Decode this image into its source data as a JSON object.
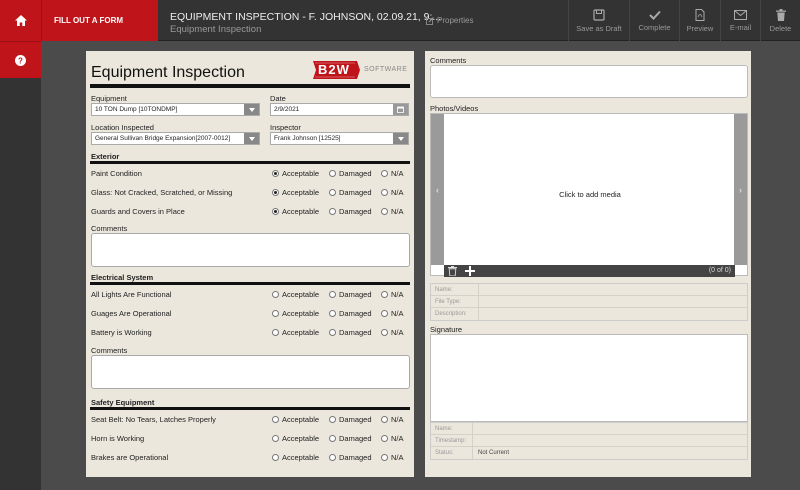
{
  "nav": {
    "fill_form": "FILL OUT A FORM"
  },
  "header": {
    "title": "EQUIPMENT INSPECTION - F. JOHNSON, 02.09.21, 9:...",
    "subtitle": "Equipment Inspection",
    "properties": "Properties"
  },
  "toolbar": {
    "save_draft": "Save as Draft",
    "complete": "Complete",
    "preview": "Preview",
    "email": "E-mail",
    "delete": "Delete"
  },
  "form": {
    "title": "Equipment Inspection",
    "logo_text": "B2W",
    "logo_sub": "SOFTWARE",
    "equipment_label": "Equipment",
    "equipment_value": "10 TON Dump [10TONDMP]",
    "date_label": "Date",
    "date_value": "2/9/2021",
    "location_label": "Location Inspected",
    "location_value": "General Sullivan Bridge Expansion[2007-0012]",
    "inspector_label": "Inspector",
    "inspector_value": "Frank Johnson [12525]",
    "options": [
      "Acceptable",
      "Damaged",
      "N/A"
    ],
    "comments_label": "Comments",
    "sections": [
      {
        "title": "Exterior",
        "questions": [
          {
            "text": "Paint Condition",
            "selected": "Acceptable"
          },
          {
            "text": "Glass: Not Cracked, Scratched, or Missing",
            "selected": "Acceptable"
          },
          {
            "text": "Guards and Covers in Place",
            "selected": "Acceptable"
          }
        ]
      },
      {
        "title": "Electrical System",
        "questions": [
          {
            "text": "All Lights Are Functional",
            "selected": ""
          },
          {
            "text": "Guages Are Operational",
            "selected": ""
          },
          {
            "text": "Battery is Working",
            "selected": ""
          }
        ]
      },
      {
        "title": "Safety Equipment",
        "questions": [
          {
            "text": "Seat Belt: No Tears, Latches Properly",
            "selected": ""
          },
          {
            "text": "Horn is Working",
            "selected": ""
          },
          {
            "text": "Brakes are Operational",
            "selected": ""
          }
        ]
      }
    ]
  },
  "right": {
    "comments_label": "Comments",
    "photos_label": "Photos/Videos",
    "click_media": "Click to add media",
    "media_count": "(0 of 0)",
    "media_meta": {
      "name": "Name:",
      "file_type": "File Type:",
      "description": "Description:"
    },
    "signature_label": "Signature",
    "sig_meta": {
      "name": "Name:",
      "timestamp": "Timestamp:",
      "status": "Status:",
      "status_value": "Not Current"
    }
  }
}
